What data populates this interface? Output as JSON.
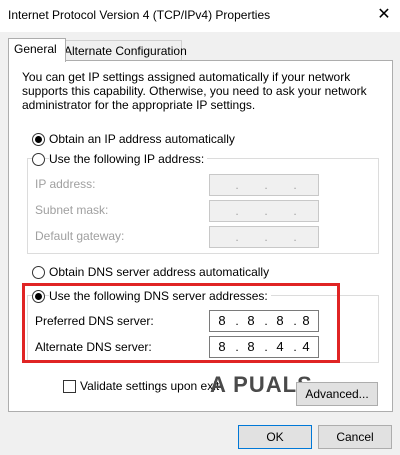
{
  "window": {
    "title": "Internet Protocol Version 4 (TCP/IPv4) Properties",
    "close_glyph": "✕"
  },
  "tabs": [
    {
      "label": "General",
      "active": true
    },
    {
      "label": "Alternate Configuration",
      "active": false
    }
  ],
  "description": "You can get IP settings assigned automatically if your network supports this capability. Otherwise, you need to ask your network administrator for the appropriate IP settings.",
  "ip": {
    "auto_label": "Obtain an IP address automatically",
    "manual_label": "Use the following IP address:",
    "selected": "auto",
    "fields": [
      {
        "label": "IP address:",
        "octets": [
          "",
          "",
          "",
          ""
        ]
      },
      {
        "label": "Subnet mask:",
        "octets": [
          "",
          "",
          "",
          ""
        ]
      },
      {
        "label": "Default gateway:",
        "octets": [
          "",
          "",
          "",
          ""
        ]
      }
    ]
  },
  "dns": {
    "auto_label": "Obtain DNS server address automatically",
    "manual_label": "Use the following DNS server addresses:",
    "selected": "manual",
    "preferred_label": "Preferred DNS server:",
    "preferred_octets": [
      "8",
      "8",
      "8",
      "8"
    ],
    "alternate_label": "Alternate DNS server:",
    "alternate_octets": [
      "8",
      "8",
      "4",
      "4"
    ]
  },
  "validate_label": "Validate settings upon exit",
  "validate_checked": false,
  "buttons": {
    "advanced": "Advanced...",
    "ok": "OK",
    "cancel": "Cancel"
  },
  "watermark": "A  PUALS",
  "highlight_color": "#e02424"
}
